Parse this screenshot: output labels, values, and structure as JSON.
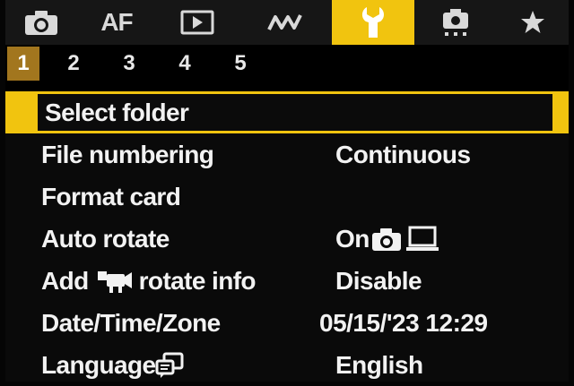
{
  "tabs": [
    {
      "id": "shooting",
      "icon": "camera-icon",
      "label": ""
    },
    {
      "id": "af",
      "icon": "",
      "label": "AF"
    },
    {
      "id": "playback",
      "icon": "playback-icon",
      "label": ""
    },
    {
      "id": "wireless",
      "icon": "wireless-icon",
      "label": ""
    },
    {
      "id": "setup",
      "icon": "wrench-icon",
      "label": "",
      "active": true
    },
    {
      "id": "custom",
      "icon": "custom-functions-icon",
      "label": ""
    },
    {
      "id": "mymenu",
      "icon": "star-icon",
      "label": ""
    }
  ],
  "pages": [
    "1",
    "2",
    "3",
    "4",
    "5"
  ],
  "active_page": "1",
  "menu": {
    "items": [
      {
        "name": "Select folder",
        "value": ""
      },
      {
        "name": "File numbering",
        "value": "Continuous"
      },
      {
        "name": "Format card",
        "value": ""
      },
      {
        "name": "Auto rotate",
        "value": "On",
        "value_icons": [
          "camera-icon",
          "computer-icon"
        ]
      },
      {
        "name_before": "Add",
        "name_icon": "movie-icon",
        "name_after": "rotate info",
        "value": "Disable"
      },
      {
        "name": "Date/Time/Zone",
        "value": "05/15/'23 12:29"
      },
      {
        "name": "Language",
        "name_icon": "language-icon",
        "value": "English"
      }
    ]
  },
  "colors": {
    "accent": "#f1c40f",
    "active_page": "#a2761e",
    "background": "#0a0a0a",
    "text": "#f2f2f2"
  }
}
